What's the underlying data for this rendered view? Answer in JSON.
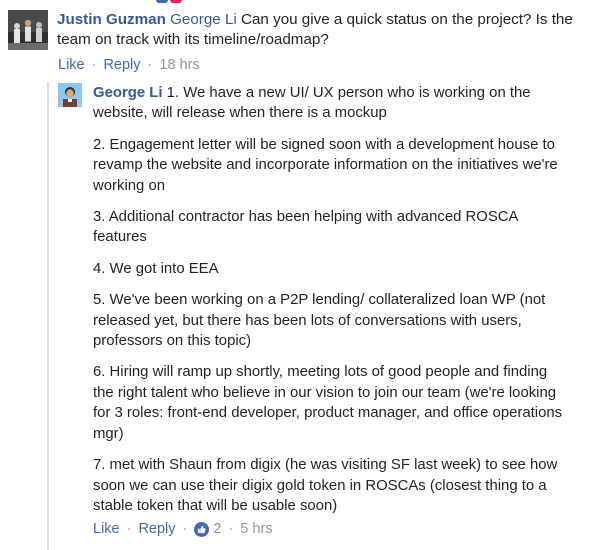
{
  "colors": {
    "link": "#365899",
    "secondary": "#90949c",
    "text": "#1d2129",
    "thread_line": "#dadde1",
    "like_badge": "#4267b2"
  },
  "main_comment": {
    "author": "Justin Guzman",
    "mention": "George Li",
    "text": " Can you give a quick status on the project? Is the team on track with its timeline/roadmap?",
    "actions": {
      "like": "Like",
      "reply": "Reply",
      "time": "18 hrs"
    },
    "avatar_icon": "profile-photo"
  },
  "reply_comment": {
    "author": "George Li",
    "paragraphs": [
      "1. We have a new UI/ UX person who is working on the website, will release when there is a mockup",
      "2. Engagement letter will be signed soon with a development house to revamp the website and incorporate information on the initiatives we're working on",
      "3. Additional contractor has been helping with advanced ROSCA features",
      "4. We got into EEA",
      "5. We've been working on a P2P lending/ collateralized loan WP (not released yet, but there has been lots of conversations with users, professors on this topic)",
      "6. Hiring will ramp up shortly, meeting lots of good people and finding the right talent who believe in our vision to join our team (we're looking for 3 roles: front-end developer, product manager, and office operations mgr)",
      "7. met with Shaun from digix (he was visiting SF last week) to see how soon we can use their digix gold token in ROSCAs (closest thing to a stable token that will be usable soon)"
    ],
    "actions": {
      "like": "Like",
      "reply": "Reply",
      "like_count": "2",
      "time": "5 hrs"
    },
    "avatar_icon": "profile-photo",
    "reaction_icon": "thumbs-up-icon"
  }
}
